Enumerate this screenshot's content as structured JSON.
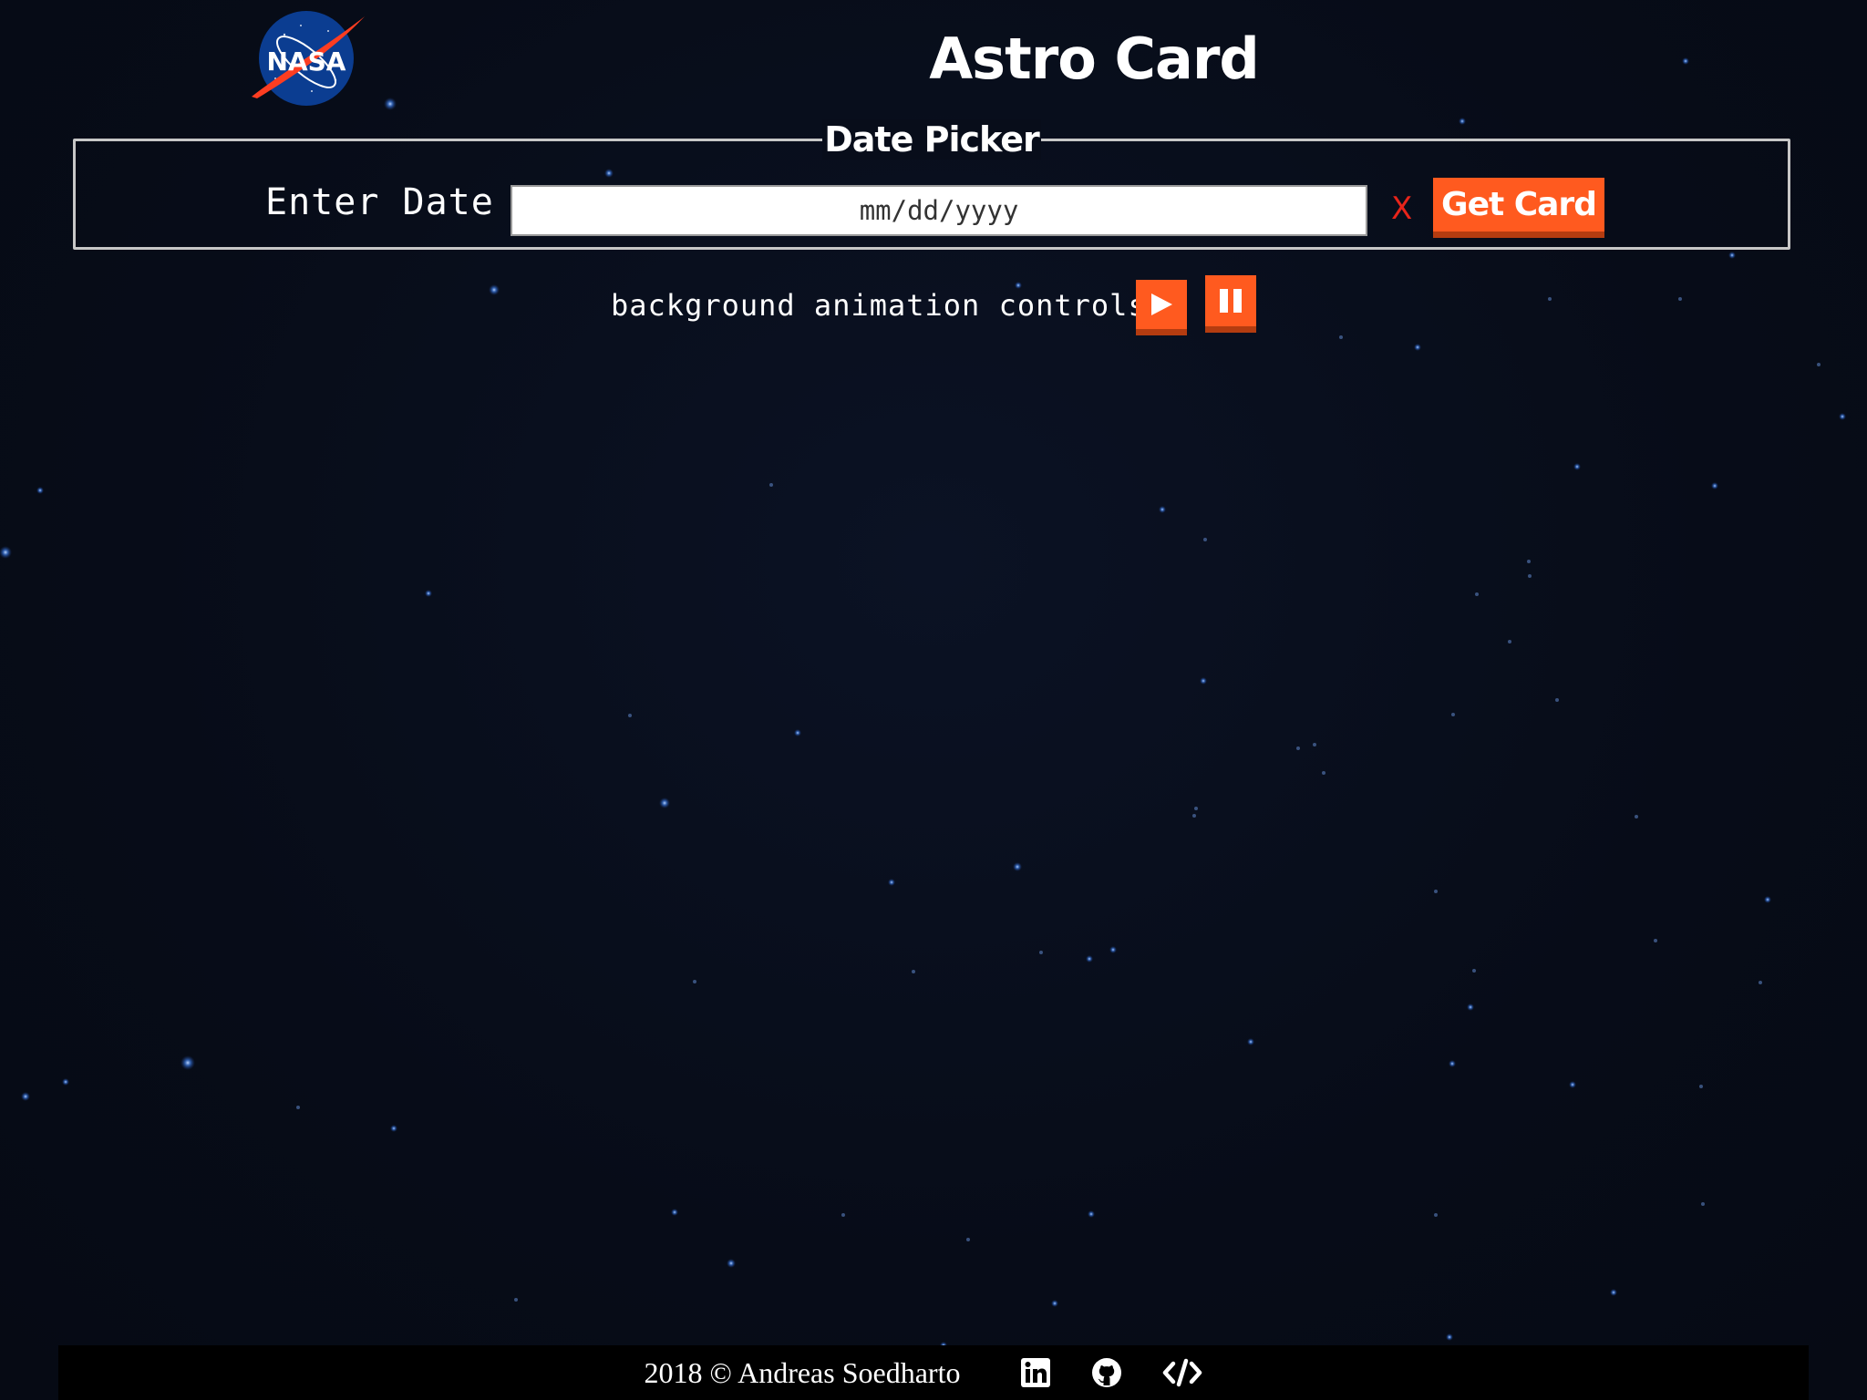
{
  "header": {
    "logo_text": "NASA",
    "title": "Astro Card"
  },
  "date_picker": {
    "legend": "Date Picker",
    "enter_label": "Enter Date",
    "date_input": {
      "placeholder": "mm/dd/yyyy",
      "value": ""
    },
    "clear_label": "X",
    "get_card_label": "Get Card"
  },
  "animation_controls": {
    "label": "background animation controls",
    "play_icon": "play-icon",
    "pause_icon": "pause-icon"
  },
  "footer": {
    "copyright": "2018 © Andreas Soedharto",
    "links": [
      {
        "icon": "linkedin-icon"
      },
      {
        "icon": "github-icon"
      },
      {
        "icon": "code-icon"
      }
    ]
  },
  "colors": {
    "background": "#080d1a",
    "accent_orange": "#ff5a1f",
    "accent_orange_shadow": "#b43c10",
    "clear_red": "#e8241a",
    "nasa_blue": "#0b3d91",
    "nasa_red": "#fc3d21",
    "footer_bg": "#000000"
  }
}
